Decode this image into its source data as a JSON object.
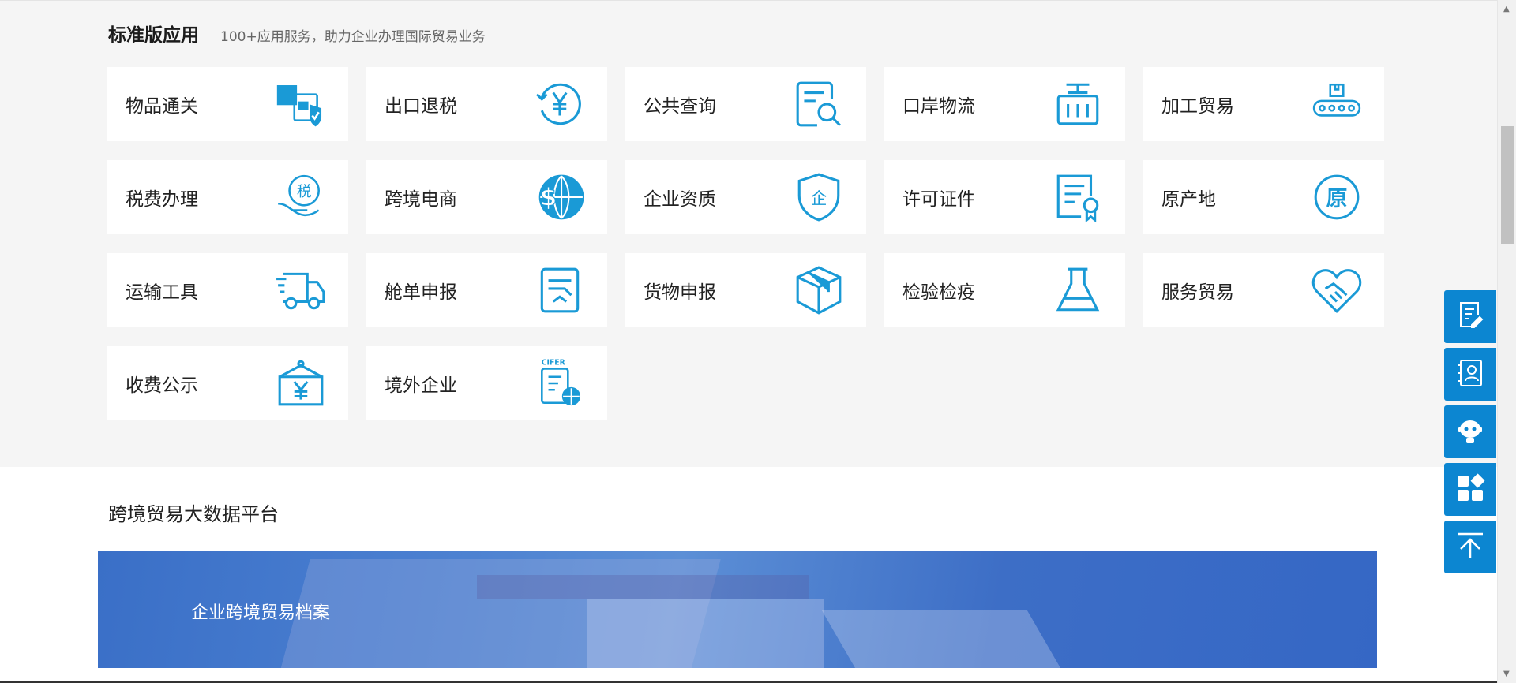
{
  "standard_apps": {
    "title": "标准版应用",
    "subtitle": "100+应用服务，助力企业办理国际贸易业务",
    "items": [
      {
        "label": "物品通关",
        "icon": "parcel-shield-icon"
      },
      {
        "label": "出口退税",
        "icon": "yen-refund-icon"
      },
      {
        "label": "公共查询",
        "icon": "document-search-icon"
      },
      {
        "label": "口岸物流",
        "icon": "shopping-basket-icon"
      },
      {
        "label": "加工贸易",
        "icon": "conveyor-belt-icon"
      },
      {
        "label": "税费办理",
        "icon": "tax-hand-icon"
      },
      {
        "label": "跨境电商",
        "icon": "dollar-globe-icon"
      },
      {
        "label": "企业资质",
        "icon": "enterprise-shield-icon"
      },
      {
        "label": "许可证件",
        "icon": "certificate-icon"
      },
      {
        "label": "原产地",
        "icon": "origin-circle-icon"
      },
      {
        "label": "运输工具",
        "icon": "truck-icon"
      },
      {
        "label": "舱单申报",
        "icon": "manifest-icon"
      },
      {
        "label": "货物申报",
        "icon": "cargo-box-icon"
      },
      {
        "label": "检验检疫",
        "icon": "flask-icon"
      },
      {
        "label": "服务贸易",
        "icon": "heart-handshake-icon"
      },
      {
        "label": "收费公示",
        "icon": "yen-sign-board-icon"
      },
      {
        "label": "境外企业",
        "icon": "cifer-clipboard-icon"
      }
    ]
  },
  "big_data": {
    "title": "跨境贸易大数据平台",
    "banner_label": "企业跨境贸易档案"
  },
  "float_bar": [
    {
      "icon": "edit-document-icon"
    },
    {
      "icon": "contacts-icon"
    },
    {
      "icon": "robot-assistant-icon"
    },
    {
      "icon": "apps-grid-icon"
    },
    {
      "icon": "back-to-top-icon"
    }
  ],
  "colors": {
    "accent": "#0c86d1",
    "icon": "#1a9ad6",
    "page_bg": "#f5f5f5"
  }
}
